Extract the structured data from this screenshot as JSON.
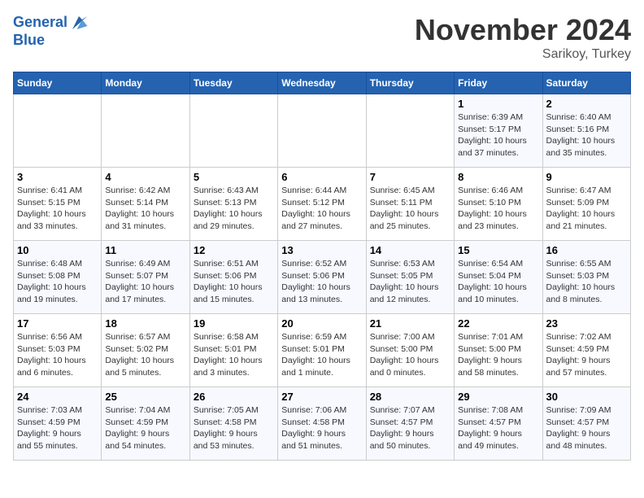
{
  "logo": {
    "line1": "General",
    "line2": "Blue"
  },
  "title": "November 2024",
  "subtitle": "Sarikoy, Turkey",
  "days_of_week": [
    "Sunday",
    "Monday",
    "Tuesday",
    "Wednesday",
    "Thursday",
    "Friday",
    "Saturday"
  ],
  "weeks": [
    {
      "cells": [
        {
          "day": null,
          "info": ""
        },
        {
          "day": null,
          "info": ""
        },
        {
          "day": null,
          "info": ""
        },
        {
          "day": null,
          "info": ""
        },
        {
          "day": null,
          "info": ""
        },
        {
          "day": "1",
          "info": "Sunrise: 6:39 AM\nSunset: 5:17 PM\nDaylight: 10 hours\nand 37 minutes."
        },
        {
          "day": "2",
          "info": "Sunrise: 6:40 AM\nSunset: 5:16 PM\nDaylight: 10 hours\nand 35 minutes."
        }
      ]
    },
    {
      "cells": [
        {
          "day": "3",
          "info": "Sunrise: 6:41 AM\nSunset: 5:15 PM\nDaylight: 10 hours\nand 33 minutes."
        },
        {
          "day": "4",
          "info": "Sunrise: 6:42 AM\nSunset: 5:14 PM\nDaylight: 10 hours\nand 31 minutes."
        },
        {
          "day": "5",
          "info": "Sunrise: 6:43 AM\nSunset: 5:13 PM\nDaylight: 10 hours\nand 29 minutes."
        },
        {
          "day": "6",
          "info": "Sunrise: 6:44 AM\nSunset: 5:12 PM\nDaylight: 10 hours\nand 27 minutes."
        },
        {
          "day": "7",
          "info": "Sunrise: 6:45 AM\nSunset: 5:11 PM\nDaylight: 10 hours\nand 25 minutes."
        },
        {
          "day": "8",
          "info": "Sunrise: 6:46 AM\nSunset: 5:10 PM\nDaylight: 10 hours\nand 23 minutes."
        },
        {
          "day": "9",
          "info": "Sunrise: 6:47 AM\nSunset: 5:09 PM\nDaylight: 10 hours\nand 21 minutes."
        }
      ]
    },
    {
      "cells": [
        {
          "day": "10",
          "info": "Sunrise: 6:48 AM\nSunset: 5:08 PM\nDaylight: 10 hours\nand 19 minutes."
        },
        {
          "day": "11",
          "info": "Sunrise: 6:49 AM\nSunset: 5:07 PM\nDaylight: 10 hours\nand 17 minutes."
        },
        {
          "day": "12",
          "info": "Sunrise: 6:51 AM\nSunset: 5:06 PM\nDaylight: 10 hours\nand 15 minutes."
        },
        {
          "day": "13",
          "info": "Sunrise: 6:52 AM\nSunset: 5:06 PM\nDaylight: 10 hours\nand 13 minutes."
        },
        {
          "day": "14",
          "info": "Sunrise: 6:53 AM\nSunset: 5:05 PM\nDaylight: 10 hours\nand 12 minutes."
        },
        {
          "day": "15",
          "info": "Sunrise: 6:54 AM\nSunset: 5:04 PM\nDaylight: 10 hours\nand 10 minutes."
        },
        {
          "day": "16",
          "info": "Sunrise: 6:55 AM\nSunset: 5:03 PM\nDaylight: 10 hours\nand 8 minutes."
        }
      ]
    },
    {
      "cells": [
        {
          "day": "17",
          "info": "Sunrise: 6:56 AM\nSunset: 5:03 PM\nDaylight: 10 hours\nand 6 minutes."
        },
        {
          "day": "18",
          "info": "Sunrise: 6:57 AM\nSunset: 5:02 PM\nDaylight: 10 hours\nand 5 minutes."
        },
        {
          "day": "19",
          "info": "Sunrise: 6:58 AM\nSunset: 5:01 PM\nDaylight: 10 hours\nand 3 minutes."
        },
        {
          "day": "20",
          "info": "Sunrise: 6:59 AM\nSunset: 5:01 PM\nDaylight: 10 hours\nand 1 minute."
        },
        {
          "day": "21",
          "info": "Sunrise: 7:00 AM\nSunset: 5:00 PM\nDaylight: 10 hours\nand 0 minutes."
        },
        {
          "day": "22",
          "info": "Sunrise: 7:01 AM\nSunset: 5:00 PM\nDaylight: 9 hours\nand 58 minutes."
        },
        {
          "day": "23",
          "info": "Sunrise: 7:02 AM\nSunset: 4:59 PM\nDaylight: 9 hours\nand 57 minutes."
        }
      ]
    },
    {
      "cells": [
        {
          "day": "24",
          "info": "Sunrise: 7:03 AM\nSunset: 4:59 PM\nDaylight: 9 hours\nand 55 minutes."
        },
        {
          "day": "25",
          "info": "Sunrise: 7:04 AM\nSunset: 4:59 PM\nDaylight: 9 hours\nand 54 minutes."
        },
        {
          "day": "26",
          "info": "Sunrise: 7:05 AM\nSunset: 4:58 PM\nDaylight: 9 hours\nand 53 minutes."
        },
        {
          "day": "27",
          "info": "Sunrise: 7:06 AM\nSunset: 4:58 PM\nDaylight: 9 hours\nand 51 minutes."
        },
        {
          "day": "28",
          "info": "Sunrise: 7:07 AM\nSunset: 4:57 PM\nDaylight: 9 hours\nand 50 minutes."
        },
        {
          "day": "29",
          "info": "Sunrise: 7:08 AM\nSunset: 4:57 PM\nDaylight: 9 hours\nand 49 minutes."
        },
        {
          "day": "30",
          "info": "Sunrise: 7:09 AM\nSunset: 4:57 PM\nDaylight: 9 hours\nand 48 minutes."
        }
      ]
    }
  ]
}
